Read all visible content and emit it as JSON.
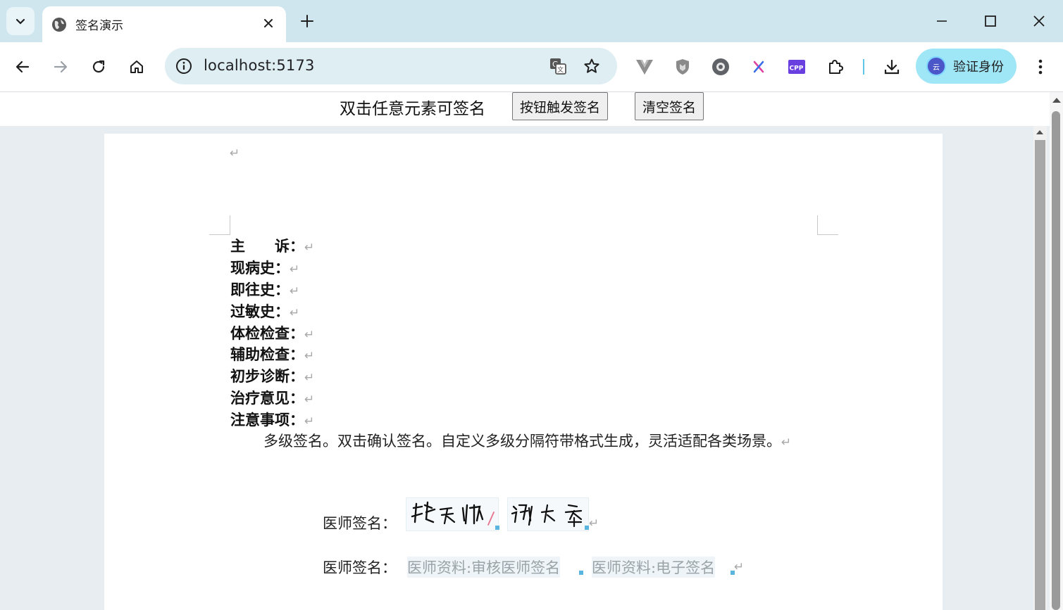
{
  "browser": {
    "tab_title": "签名演示",
    "url": "localhost:5173",
    "profile_button": "验证身份",
    "profile_avatar_text": "云",
    "ext_cpp_label": "CPP"
  },
  "toolbar_page": {
    "hint": "双击任意元素可签名",
    "trigger_button": "按钮触发签名",
    "clear_button": "清空签名"
  },
  "document": {
    "fields": [
      {
        "label": "主　　诉："
      },
      {
        "label": "现病史："
      },
      {
        "label": "即往史："
      },
      {
        "label": "过敏史："
      },
      {
        "label": "体检检查："
      },
      {
        "label": "辅助检查："
      },
      {
        "label": "初步诊断："
      },
      {
        "label": "治疗意见："
      },
      {
        "label": "注意事项："
      }
    ],
    "paragraph": "多级签名。双击确认签名。自定义多级分隔符带格式生成，灵活适配各类场景。",
    "pilcrow": "↵",
    "signature_rows": [
      {
        "label": "医师签名："
      },
      {
        "label": "医师签名：",
        "placeholders": [
          "医师资料:审核医师签名",
          "医师资料:电子签名"
        ]
      }
    ]
  },
  "colors": {
    "tabbar": "#cfe6ee",
    "omnibox": "#dfeef3",
    "profile": "#9fe6f6",
    "handle": "#5ab4e0"
  }
}
